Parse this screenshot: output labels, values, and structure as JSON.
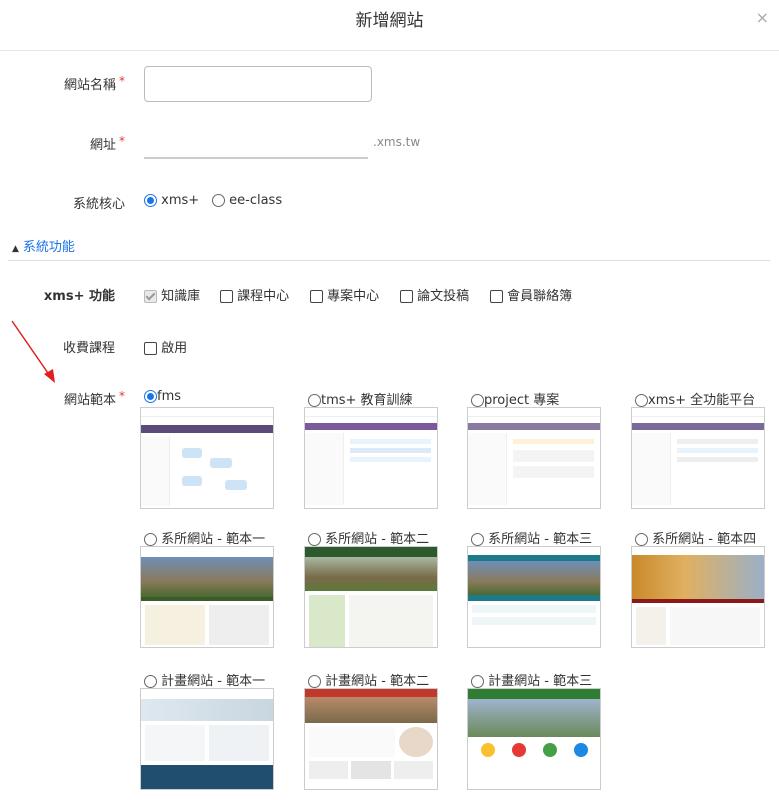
{
  "dialog": {
    "title": "新增網站",
    "close": "×"
  },
  "fields": {
    "site_name": {
      "label": "網站名稱",
      "required": "*",
      "value": ""
    },
    "url": {
      "label": "網址",
      "required": "*",
      "value": "",
      "suffix": ".xms.tw"
    },
    "core": {
      "label": "系統核心",
      "options": [
        "xms+",
        "ee-class"
      ],
      "selected": "xms+"
    }
  },
  "section": {
    "label": "系統功能",
    "arrow": "▲"
  },
  "features": {
    "label": "xms+ 功能",
    "options": [
      "知識庫",
      "課程中心",
      "專案中心",
      "論文投稿",
      "會員聯絡簿"
    ]
  },
  "paid": {
    "label": "收費課程",
    "option": "啟用"
  },
  "template": {
    "label": "網站範本",
    "required": "*",
    "selected": "fms",
    "items": [
      "fms",
      "tms+ 教育訓練",
      "project 專案",
      "xms+ 全功能平台",
      "系所網站 - 範本一",
      "系所網站 - 範本二",
      "系所網站 - 範本三",
      "系所網站 - 範本四",
      "計畫網站 - 範本一",
      "計畫網站 - 範本二",
      "計畫網站 - 範本三"
    ]
  },
  "colors": {
    "accent": "#1a73e8",
    "required": "#e53935",
    "annotation_arrow": "#e02020"
  }
}
